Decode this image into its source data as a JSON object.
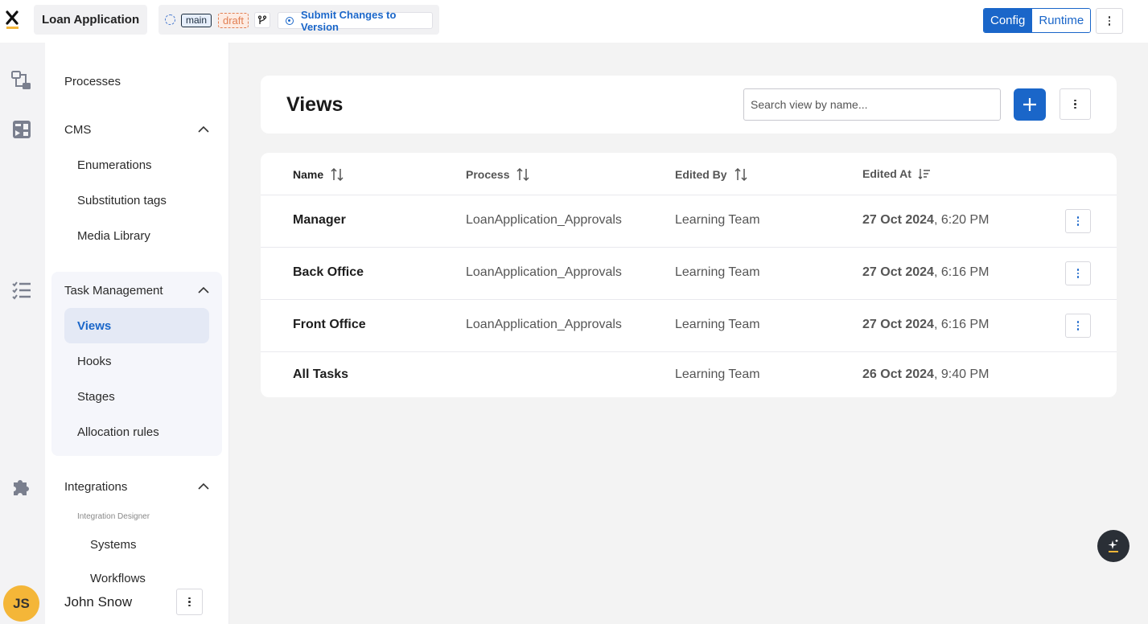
{
  "header": {
    "app_title": "Loan Application",
    "branch": "main",
    "status": "draft",
    "submit_label": "Submit Changes to Version",
    "mode_config": "Config",
    "mode_runtime": "Runtime",
    "active_mode": "Config"
  },
  "rail": {
    "icons": [
      "processes-icon",
      "dashboard-icon",
      "task-list-icon",
      "integrations-icon"
    ]
  },
  "sidebar": {
    "processes": "Processes",
    "cms": {
      "label": "CMS",
      "items": [
        "Enumerations",
        "Substitution tags",
        "Media Library"
      ]
    },
    "task_management": {
      "label": "Task Management",
      "items": [
        "Views",
        "Hooks",
        "Stages",
        "Allocation rules"
      ],
      "active": "Views"
    },
    "integrations": {
      "label": "Integrations",
      "section": "Integration Designer",
      "items": [
        "Systems",
        "Workflows"
      ]
    },
    "user": {
      "initials": "JS",
      "name": "John Snow"
    }
  },
  "main": {
    "title": "Views",
    "search_placeholder": "Search view by name...",
    "columns": [
      "Name",
      "Process",
      "Edited By",
      "Edited At"
    ],
    "rows": [
      {
        "name": "Manager",
        "process": "LoanApplication_Approvals",
        "edited_by": "Learning Team",
        "date": "27 Oct 2024",
        "time": ", 6:20 PM"
      },
      {
        "name": "Back Office",
        "process": "LoanApplication_Approvals",
        "edited_by": "Learning Team",
        "date": "27 Oct 2024",
        "time": ", 6:16 PM"
      },
      {
        "name": "Front Office",
        "process": "LoanApplication_Approvals",
        "edited_by": "Learning Team",
        "date": "27 Oct 2024",
        "time": ", 6:16 PM"
      },
      {
        "name": "All Tasks",
        "process": "",
        "edited_by": "Learning Team",
        "date": "26 Oct 2024",
        "time": ", 9:40 PM"
      }
    ]
  },
  "colors": {
    "accent": "#1a66c9",
    "draft": "#e17f53",
    "avatar": "#f4b638",
    "fab": "#2a2f36"
  }
}
